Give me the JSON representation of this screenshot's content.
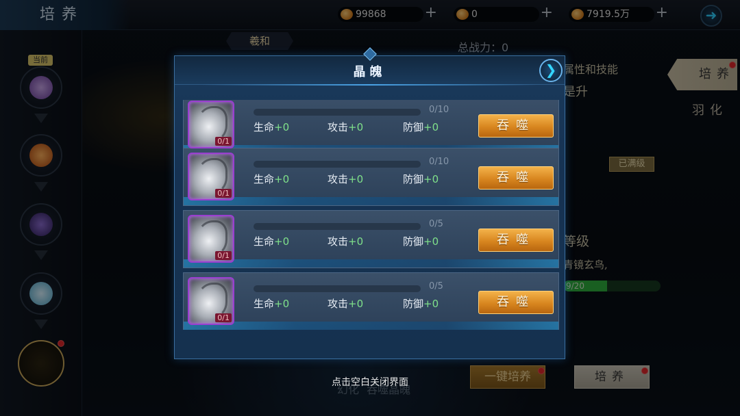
{
  "topbar": {
    "title": "培养",
    "resources": [
      {
        "icon": "gold-coin-icon",
        "value": "99868"
      },
      {
        "icon": "ingot-icon",
        "value": "0"
      },
      {
        "icon": "copper-coin-icon",
        "value": "7919.5万"
      }
    ],
    "plus": "+"
  },
  "scene": {
    "pet_name": "羲和",
    "power_label": "总战力：0",
    "current_label": "当前",
    "right": {
      "attr_title": "属性和技能",
      "upgrade": "是升",
      "maxed": "已满级",
      "level": "等级",
      "desc": "青镜玄鸟,",
      "progress": "9/20",
      "progress_value": 0.45
    },
    "side_tabs": [
      "培养",
      "羽化"
    ],
    "btn_auto": "一键培养",
    "btn_train": "培养",
    "bottom_faded": "幻化     吞噬晶魄"
  },
  "modal": {
    "title": "晶魄",
    "rows": [
      {
        "count": "0/1",
        "progress": "0/10",
        "hp": "生命",
        "hp_v": "+0",
        "atk": "攻击",
        "atk_v": "+0",
        "def": "防御",
        "def_v": "+0",
        "button": "吞噬"
      },
      {
        "count": "0/1",
        "progress": "0/10",
        "hp": "生命",
        "hp_v": "+0",
        "atk": "攻击",
        "atk_v": "+0",
        "def": "防御",
        "def_v": "+0",
        "button": "吞噬"
      },
      {
        "count": "0/1",
        "progress": "0/5",
        "hp": "生命",
        "hp_v": "+0",
        "atk": "攻击",
        "atk_v": "+0",
        "def": "防御",
        "def_v": "+0",
        "button": "吞噬"
      },
      {
        "count": "0/1",
        "progress": "0/5",
        "hp": "生命",
        "hp_v": "+0",
        "atk": "攻击",
        "atk_v": "+0",
        "def": "防御",
        "def_v": "+0",
        "button": "吞噬"
      }
    ]
  },
  "close_hint": "点击空白关闭界面"
}
